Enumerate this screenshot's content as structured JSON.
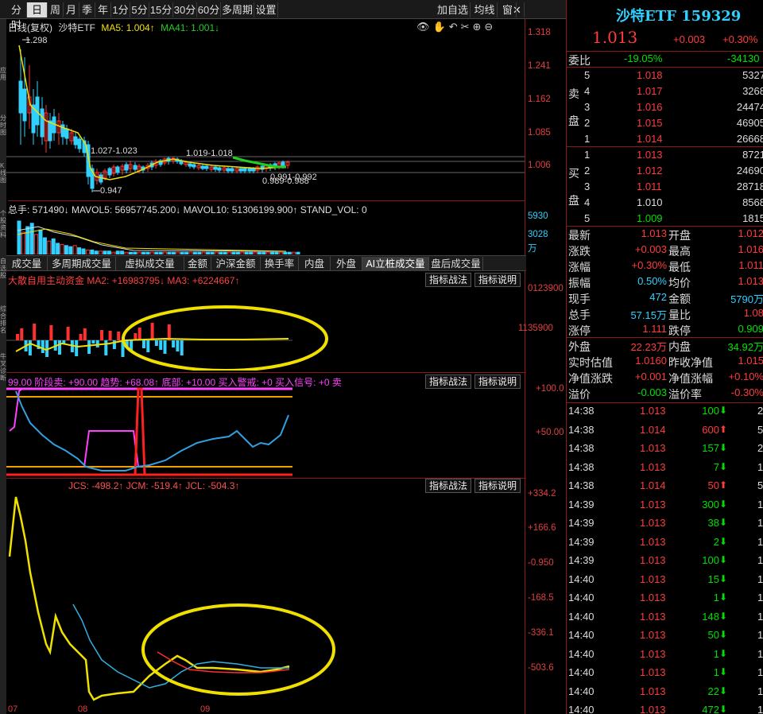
{
  "toolbar": {
    "items": [
      "分时",
      "日",
      "周",
      "月",
      "季",
      "年",
      "1分",
      "5分",
      "15分",
      "30分",
      "60分",
      "多周期",
      "设置"
    ],
    "right": [
      "加自选",
      "均线",
      "窗"
    ]
  },
  "left_vertical_labels": [
    "应用",
    "分时图",
    "K线图",
    "个股资料",
    "自选股",
    "综合排名",
    "牛叉诊断"
  ],
  "main": {
    "title": "日线(复权)",
    "name": "沙特ETF",
    "ma5": "MA5: 1.004↑",
    "ma41": "MA41: 1.001↓",
    "ylabels": [
      "1.318",
      "1.241",
      "1.162",
      "1.085",
      "1.006"
    ],
    "annotations": {
      "high": "1.298",
      "range1": "1.027-1.023",
      "range2": "1.019-1.018",
      "low": "0.947",
      "range3": "0.991-0.992",
      "range4": "0.989-0.988"
    }
  },
  "volume": {
    "header": "总手: 571490↓ MAVOL5: 56957745.200↓ MAVOL10: 51306199.900↑ STAND_VOL: 0",
    "ylabels": [
      "5930",
      "3028",
      "万"
    ]
  },
  "tabs": [
    "成交量",
    "多周期成交量",
    "虚拟成交量",
    "金额",
    "沪深金额",
    "换手率",
    "内盘",
    "外盘",
    "AI立桩成交量",
    "盘后成交量"
  ],
  "ind1": {
    "header": "大散自用主动资金 MA2: +16983795↓ MA3: +6224667↑",
    "btn1": "指标战法",
    "btn2": "指标说明",
    "ylabels": [
      "0123900",
      "1135900"
    ]
  },
  "ind2": {
    "header": "99.00 阶段卖: +90.00 趋势: +68.08↑ 底部: +10.00 买入警戒: +0 买入信号: +0 卖",
    "btn1": "指标战法",
    "btn2": "指标说明",
    "ylabels": [
      "+100.0",
      "+50.00"
    ]
  },
  "ind3": {
    "header": "JCS: -498.2↑ JCM: -519.4↑ JCL: -504.3↑",
    "btn1": "指标战法",
    "btn2": "指标说明",
    "ylabels": [
      "+334.2",
      "+166.6",
      "-0.950",
      "-168.5",
      "-336.1",
      "-503.6"
    ],
    "xlabels": [
      "07",
      "08",
      "09"
    ]
  },
  "quote": {
    "name": "沙特ETF 159329",
    "price": "1.013",
    "change": "+0.003",
    "pct": "+0.30%",
    "weibi_label": "委比",
    "weibi": "-19.05%",
    "weicha": "-34130",
    "sell_label": "卖盘",
    "buy_label": "买盘",
    "sell": [
      [
        "5",
        "1.018",
        "5327"
      ],
      [
        "4",
        "1.017",
        "3268"
      ],
      [
        "3",
        "1.016",
        "24474"
      ],
      [
        "2",
        "1.015",
        "46905"
      ],
      [
        "1",
        "1.014",
        "26668"
      ]
    ],
    "buy": [
      [
        "1",
        "1.013",
        "8721"
      ],
      [
        "2",
        "1.012",
        "24690"
      ],
      [
        "3",
        "1.011",
        "28718"
      ],
      [
        "4",
        "1.010",
        "8568"
      ],
      [
        "5",
        "1.009",
        "1815"
      ]
    ],
    "stats": [
      [
        "最新",
        "1.013",
        "开盘",
        "1.012"
      ],
      [
        "涨跌",
        "+0.003",
        "最高",
        "1.016"
      ],
      [
        "涨幅",
        "+0.30%",
        "最低",
        "1.011"
      ],
      [
        "振幅",
        "0.50%",
        "均价",
        "1.013"
      ],
      [
        "现手",
        "472",
        "金额",
        "5790万"
      ],
      [
        "总手",
        "57.15万",
        "量比",
        "1.08"
      ],
      [
        "涨停",
        "1.111",
        "跌停",
        "0.909"
      ]
    ],
    "waipan": "外盘",
    "waipan_v": "22.23万",
    "neipan": "内盘",
    "neipan_v": "34.92万",
    "est": [
      [
        "实时估值",
        "1.0160",
        "昨收净值",
        "1.015"
      ],
      [
        "净值涨跌",
        "+0.001",
        "净值涨幅",
        "+0.10%"
      ],
      [
        "溢价",
        "-0.003",
        "溢价率",
        "-0.30%"
      ]
    ],
    "ticks": [
      [
        "14:38",
        "1.013",
        "100",
        "d"
      ],
      [
        "14:38",
        "1.014",
        "600",
        "u"
      ],
      [
        "14:38",
        "1.013",
        "157",
        "d"
      ],
      [
        "14:38",
        "1.013",
        "7",
        "d"
      ],
      [
        "14:38",
        "1.014",
        "50",
        "u"
      ],
      [
        "14:39",
        "1.013",
        "300",
        "d"
      ],
      [
        "14:39",
        "1.013",
        "38",
        "d"
      ],
      [
        "14:39",
        "1.013",
        "2",
        "d"
      ],
      [
        "14:39",
        "1.013",
        "100",
        "d"
      ],
      [
        "14:40",
        "1.013",
        "15",
        "d"
      ],
      [
        "14:40",
        "1.013",
        "1",
        "d"
      ],
      [
        "14:40",
        "1.013",
        "148",
        "d"
      ],
      [
        "14:40",
        "1.013",
        "50",
        "d"
      ],
      [
        "14:40",
        "1.013",
        "1",
        "d"
      ],
      [
        "14:40",
        "1.013",
        "1",
        "d"
      ],
      [
        "14:40",
        "1.013",
        "22",
        "d"
      ],
      [
        "14:40",
        "1.013",
        "472",
        "d"
      ]
    ],
    "tick_tail": [
      "2",
      "5",
      "2",
      "1",
      "5",
      "1",
      "1",
      "1",
      "1",
      "1",
      "1",
      "1",
      "1",
      "1",
      "1",
      "1",
      "1"
    ]
  }
}
